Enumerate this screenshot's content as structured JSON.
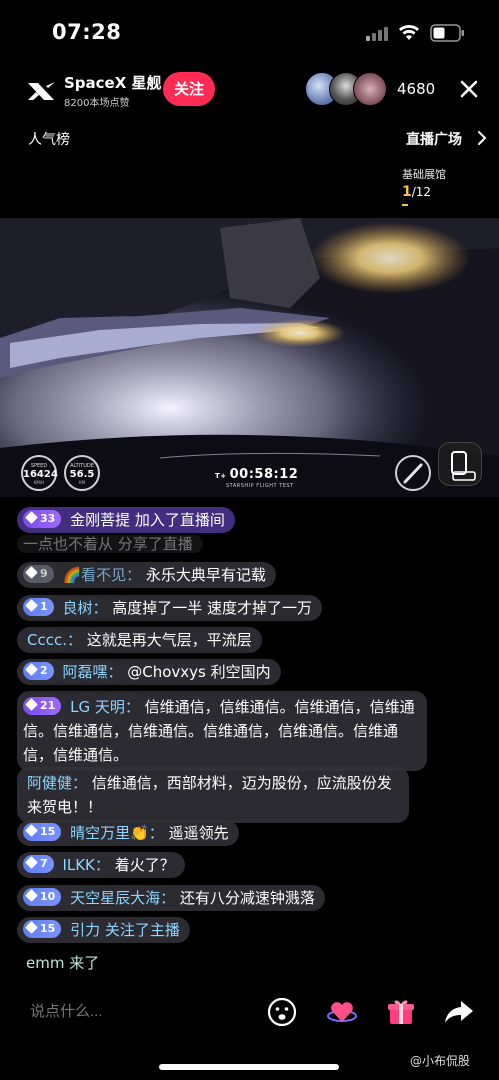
{
  "status_bar": {
    "time": "07:28"
  },
  "header": {
    "host_name": "SpaceX 星舰",
    "host_likes": "8200本场点赞",
    "follow_label": "关注",
    "viewer_count": "4680"
  },
  "subheader": {
    "popularity": "人气榜",
    "live_plaza": "直播广场",
    "showroom": "基础展馆",
    "page_current": "1",
    "page_total": "/12"
  },
  "video_hud": {
    "speed_label": "SPEED",
    "speed_value": "16424",
    "speed_unit": "KM/H",
    "alt_label": "ALTITUDE",
    "alt_value": "56.5",
    "alt_unit": "KM",
    "t_plus": "T+",
    "timer": "00:58:12",
    "subtitle": "STARSHIP FLIGHT TEST"
  },
  "chat": {
    "join_notice": {
      "level": "33",
      "user": "金刚菩提",
      "text": "加入了直播间"
    },
    "faded_line": "一点也不着从 分享了直播",
    "messages": [
      {
        "level": "9",
        "user": "🌈看不见：",
        "text": "永乐大典早有记载"
      },
      {
        "level": "1",
        "user": "良树：",
        "text": "高度掉了一半 速度才掉了一万"
      },
      {
        "level": "",
        "user": "Cccc.：",
        "text": "这就是再大气层，平流层"
      },
      {
        "level": "2",
        "user": "阿磊嘿：",
        "text": "@Chovxys 利空国内"
      },
      {
        "level": "21",
        "user": "LG 天明：",
        "text": "信维通信，信维通信。信维通信，信维通信。信维通信，信维通信。信维通信，信维通信。信维通信，信维通信。"
      },
      {
        "level": "",
        "user": "阿健健：",
        "text": "信维通信，西部材料，迈为股份，应流股份发来贺电！！"
      },
      {
        "level": "15",
        "user": "晴空万里👏：",
        "text": "遥遥领先"
      },
      {
        "level": "7",
        "user": "ILKK：",
        "text": "着火了？"
      },
      {
        "level": "10",
        "user": "天空星辰大海：",
        "text": "还有八分减速钟溅落"
      },
      {
        "level": "15",
        "user": "引力",
        "text": "关注了主播"
      },
      {
        "level": "",
        "user": "emm",
        "text": "来了"
      }
    ]
  },
  "bottom_bar": {
    "input_placeholder": "说点什么...",
    "watermark": "@小布侃股"
  },
  "colors": {
    "follow": "#fe2c55",
    "username": "#8fd5ff",
    "badge_blue": "#5f7df5",
    "page_accent": "#f5c242"
  }
}
